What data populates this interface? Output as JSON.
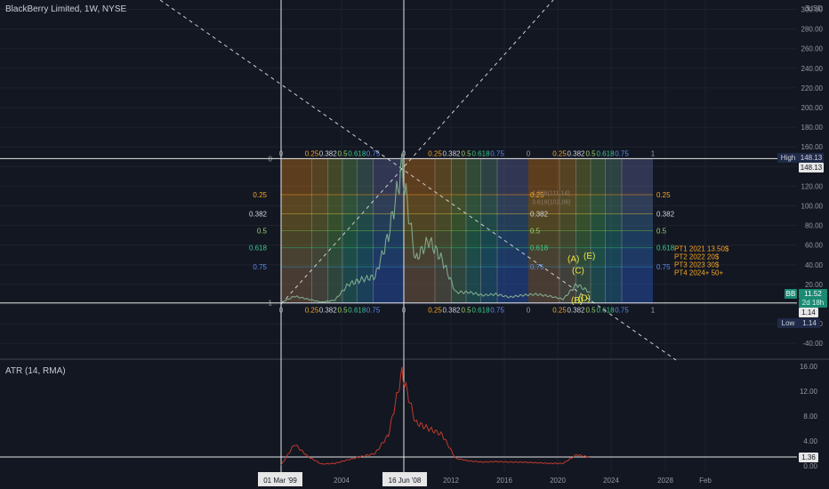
{
  "header": {
    "symbol_line": "BlackBerry Limited, 1W, NYSE",
    "currency": "USD",
    "currency_icon": "3"
  },
  "colors": {
    "background": "#131722",
    "grid": "#1e222d",
    "price": "#7fa88c",
    "atr": "#c0392b",
    "white": "#d1d4dc",
    "yellow": "#f0e442",
    "orange": "#f5a623",
    "fib_orange": "#c77a1a",
    "fib_green": "#2e9e6b",
    "fib_blue": "#2f5fd0"
  },
  "price_axis": {
    "ticks": [
      "300.00",
      "280.00",
      "260.00",
      "240.00",
      "220.00",
      "200.00",
      "180.00",
      "160.00",
      "140.00",
      "120.00",
      "100.00",
      "80.00",
      "60.00",
      "40.00",
      "20.00",
      "0.00",
      "-20.00",
      "-40.00"
    ]
  },
  "atr_axis": {
    "ticks": [
      "16.00",
      "12.00",
      "8.00",
      "4.00",
      "0.00"
    ]
  },
  "price_labels": {
    "high_tag": "High",
    "high_value": "148.13",
    "high_value2": "148.13",
    "bb_tag": "BB",
    "last_price": "11.52",
    "countdown": "2d 18h",
    "low_value": "1.14",
    "low_tag": "Low",
    "low_value2": "1.14"
  },
  "atr_labels": {
    "title": "ATR (14, RMA)",
    "value": "1.36"
  },
  "time_axis": {
    "ticks": [
      "2004",
      "2012",
      "2016",
      "2020",
      "2024",
      "2028",
      "Feb"
    ],
    "highlight_left": "01 Mar '99",
    "highlight_mid": "16 Jun '08"
  },
  "fib": {
    "levels": [
      "0",
      "0.25",
      "0.382",
      "0.5",
      "0.618",
      "0.75",
      "1"
    ],
    "box_levels": [
      "0.25",
      "0.382",
      "0.5",
      "0.618",
      "0.75"
    ]
  },
  "targets": [
    "PT1 2021 13.50$",
    "PT2 2022 20$",
    "PT3 2023 30$",
    "PT4 2024+ 50+"
  ],
  "waves": [
    "(A)",
    "(E)",
    "(C)",
    "(B)",
    "(D)"
  ],
  "faint_labels": [
    "4.236(111.14)",
    "3.618(102.06)"
  ],
  "chart_data": [
    {
      "type": "line",
      "title": "BlackBerry Limited, 1W, NYSE",
      "ylim": [
        -40,
        300
      ],
      "x": [
        "1999",
        "2000",
        "2001",
        "2002",
        "2003",
        "2004",
        "2005",
        "2006",
        "2007",
        "2008",
        "2009",
        "2010",
        "2011",
        "2012",
        "2013",
        "2014",
        "2015",
        "2016",
        "2017",
        "2018",
        "2019",
        "2020",
        "2021",
        "2022"
      ],
      "series": [
        {
          "values": [
            1.5,
            8,
            5,
            2,
            4,
            20,
            25,
            28,
            70,
            140,
            45,
            65,
            45,
            12,
            12,
            9,
            10,
            7,
            9,
            10,
            8,
            5,
            20,
            12
          ]
        }
      ]
    },
    {
      "type": "line",
      "title": "ATR (14, RMA)",
      "ylim": [
        0,
        17
      ],
      "x": [
        "1999",
        "2000",
        "2001",
        "2002",
        "2003",
        "2004",
        "2005",
        "2006",
        "2007",
        "2008",
        "2009",
        "2010",
        "2011",
        "2012",
        "2013",
        "2014",
        "2015",
        "2016",
        "2017",
        "2018",
        "2019",
        "2020",
        "2021",
        "2022"
      ],
      "series": [
        {
          "values": [
            0.1,
            3.5,
            1.5,
            0.3,
            0.4,
            1,
            1.5,
            2,
            5,
            15,
            7,
            6,
            5,
            1.2,
            0.8,
            0.6,
            0.7,
            0.6,
            0.6,
            0.5,
            0.4,
            0.4,
            1.8,
            1.36
          ]
        }
      ]
    }
  ]
}
